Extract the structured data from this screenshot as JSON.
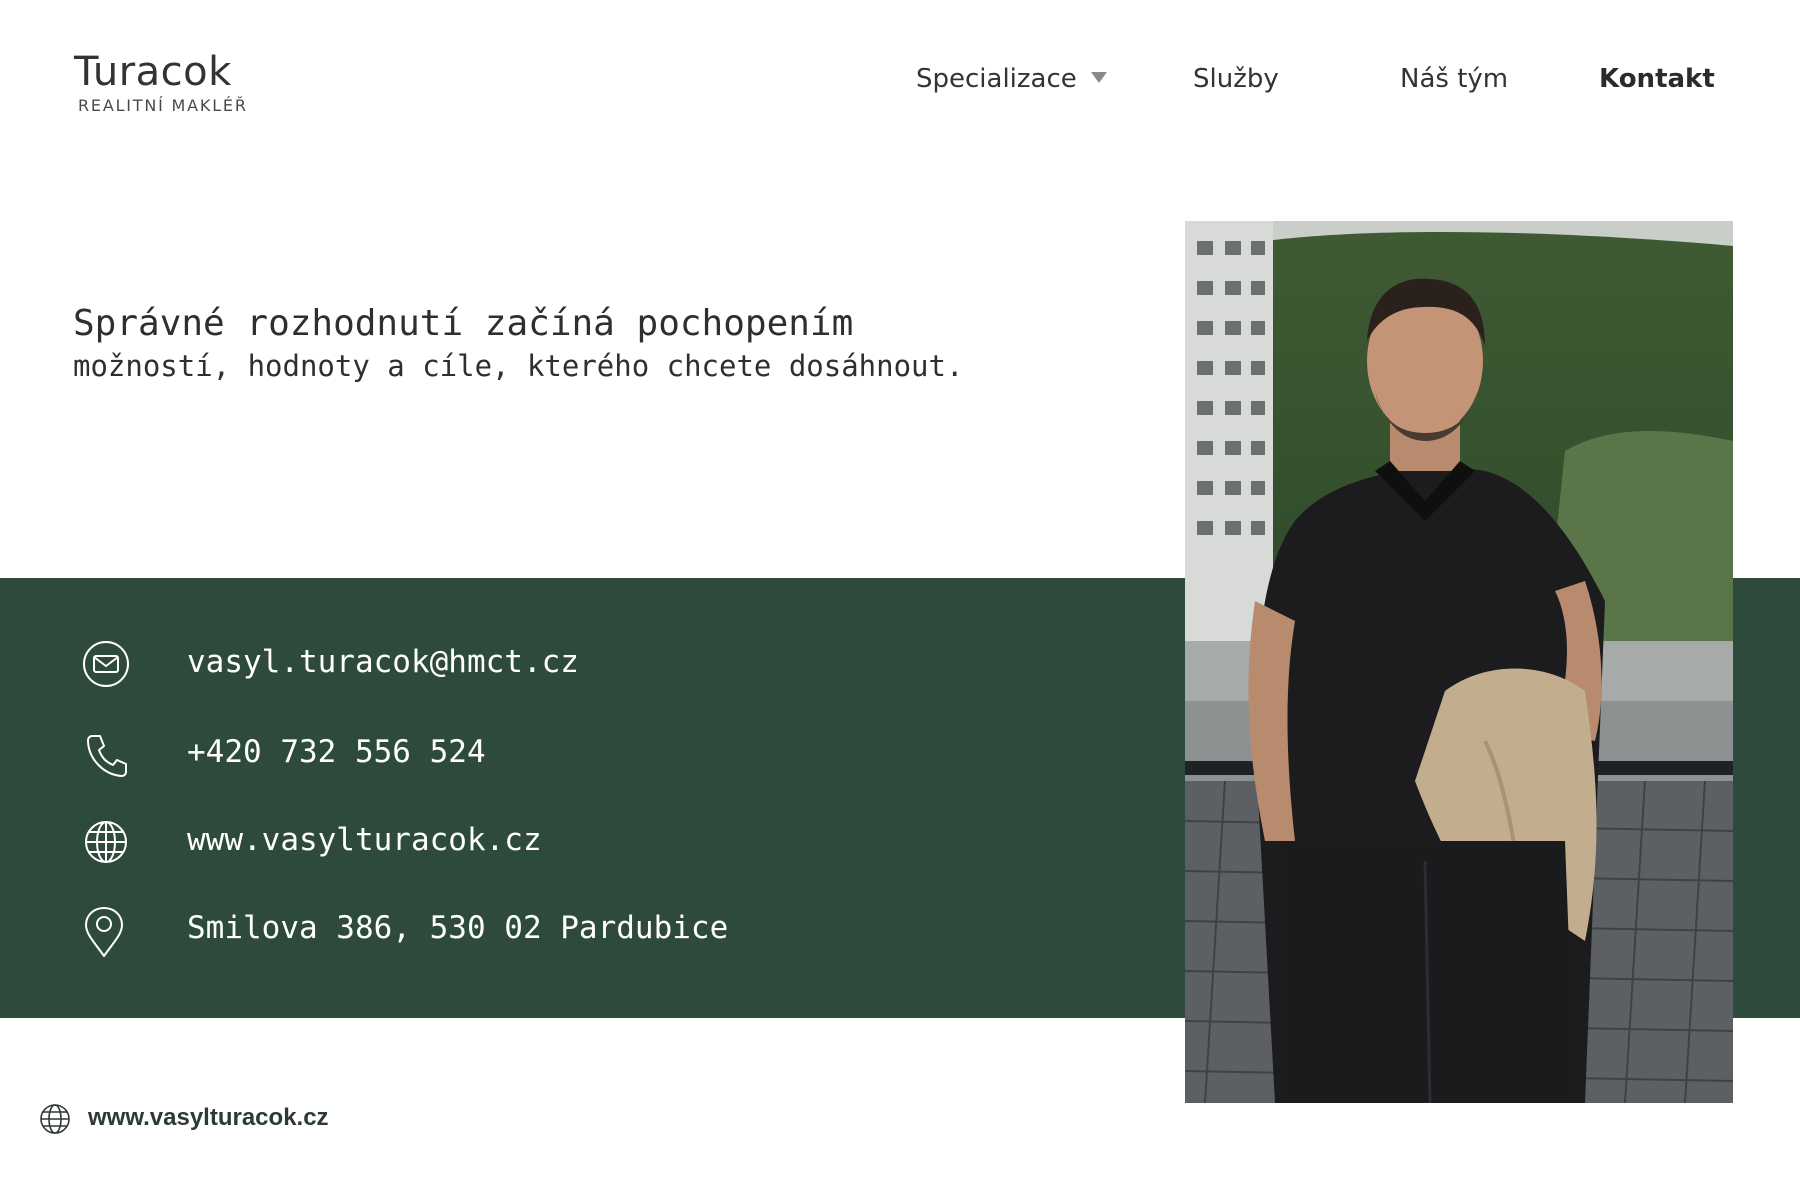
{
  "brand": {
    "name": "Turacok",
    "tagline": "REALITNÍ MAKLÉŘ"
  },
  "nav": {
    "items": [
      {
        "label": "Specializace",
        "has_dropdown": true
      },
      {
        "label": "Služby"
      },
      {
        "label": "Náš tým"
      },
      {
        "label": "Kontakt",
        "active": true
      }
    ]
  },
  "headline": {
    "line1": "Správné rozhodnutí začíná pochopením",
    "line2": "možností, hodnoty a cíle, kterého chcete dosáhnout."
  },
  "contact": {
    "email": "vasyl.turacok@hmct.cz",
    "phone": "+420 732 556 524",
    "website": "www.vasylturacok.cz",
    "address": "Smilova 386, 530 02 Pardubice"
  },
  "footer": {
    "website": "www.vasylturacok.cz"
  },
  "colors": {
    "band": "#2e4a3c",
    "text_dark": "#2b2b2b",
    "white": "#ffffff"
  },
  "icons": {
    "email": "envelope-icon",
    "phone": "phone-icon",
    "website": "globe-icon",
    "address": "map-pin-icon"
  }
}
